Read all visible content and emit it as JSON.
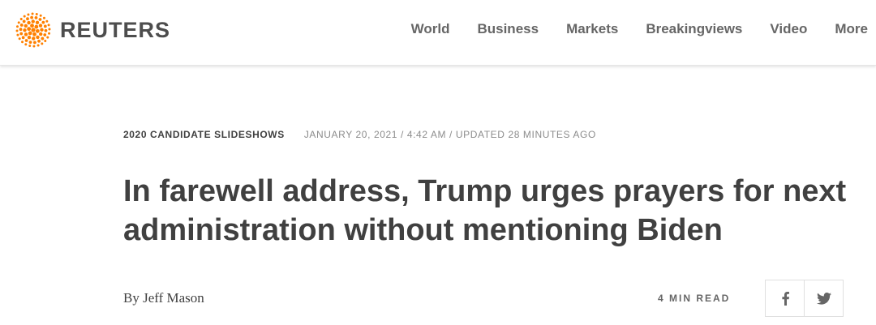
{
  "brand": {
    "name": "REUTERS",
    "accent_color": "#ff8000",
    "logo_icon": "reuters-dot-sphere-logo"
  },
  "nav": {
    "items": [
      {
        "label": "World"
      },
      {
        "label": "Business"
      },
      {
        "label": "Markets"
      },
      {
        "label": "Breakingviews"
      },
      {
        "label": "Video"
      },
      {
        "label": "More"
      }
    ]
  },
  "article": {
    "section": "2020 CANDIDATE SLIDESHOWS",
    "dateline": "JANUARY 20, 2021 / 4:42 AM / UPDATED 28 MINUTES AGO",
    "headline": "In farewell address, Trump urges prayers for next administration without mentioning Biden",
    "byline_prefix": "By",
    "author": "Jeff Mason",
    "read_time": "4 MIN READ"
  },
  "share": {
    "icons": [
      "facebook-icon",
      "twitter-icon"
    ],
    "icon_color": "#666666"
  }
}
